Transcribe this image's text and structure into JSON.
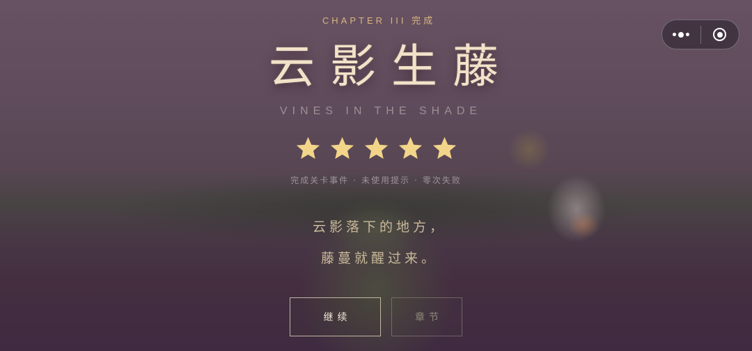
{
  "capsule": {
    "more_icon": "more-dots-icon",
    "close_icon": "target-ring-icon"
  },
  "header": {
    "chapter_label": "CHAPTER III  完成",
    "title": "云影生藤",
    "subtitle": "VINES IN THE SHADE"
  },
  "rating": {
    "stars_earned": 5,
    "stars_total": 5,
    "star_color": "#f3d58a",
    "criteria": [
      "完成关卡事件",
      "未使用提示",
      "零次失败"
    ],
    "separator": "·"
  },
  "poem": {
    "line1": "云影落下的地方，",
    "line2": "藤蔓就醒过来。"
  },
  "buttons": {
    "continue_label": "继续",
    "chapter_label": "章节"
  }
}
